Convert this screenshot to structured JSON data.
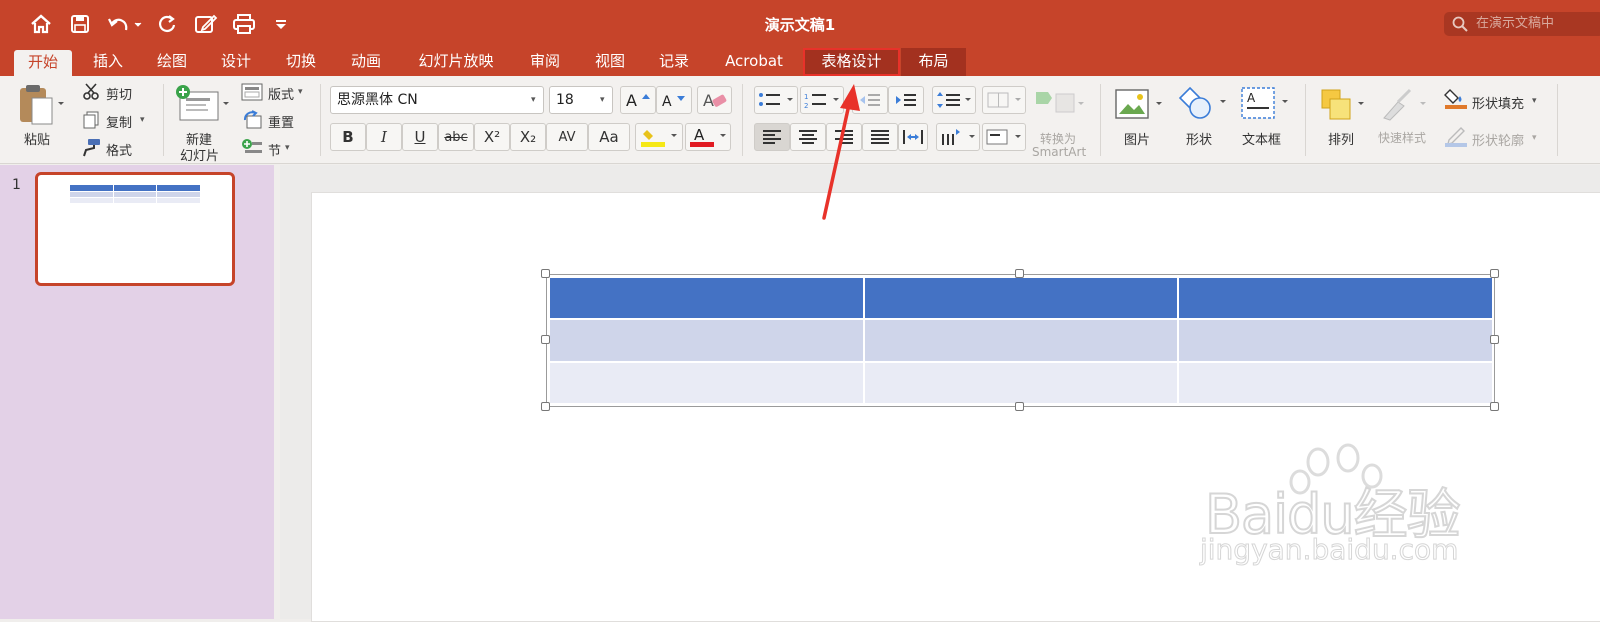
{
  "title_bar": {
    "doc_title": "演示文稿1",
    "search_placeholder": "在演示文稿中"
  },
  "tabs": [
    "开始",
    "插入",
    "绘图",
    "设计",
    "切换",
    "动画",
    "幻灯片放映",
    "审阅",
    "视图",
    "记录",
    "Acrobat",
    "表格设计",
    "布局"
  ],
  "active_tab": "开始",
  "highlighted_tab": "表格设计",
  "ribbon": {
    "paste": "粘贴",
    "cut": "剪切",
    "copy": "复制",
    "format": "格式",
    "new_slide": [
      "新建",
      "幻灯片"
    ],
    "layout": "版式",
    "reset": "重置",
    "section": "节",
    "font_name": "思源黑体 CN",
    "font_size": "18",
    "bold": "B",
    "italic": "I",
    "underline": "U",
    "strike": "abc",
    "superscript": "X²",
    "subscript": "X₂",
    "char_spacing": "AV",
    "change_case": "Aa",
    "smartart": [
      "转换为",
      "SmartArt"
    ],
    "picture": "图片",
    "shapes": "形状",
    "text_box": "文本框",
    "arrange": "排列",
    "quick_styles": "快速样式",
    "shape_fill": "形状填充",
    "shape_outline": "形状轮廓"
  },
  "slides": {
    "thumbnail_number": "1"
  },
  "table": {
    "rows": 3,
    "cols": 3,
    "header_color": "#4472c4",
    "band1_color": "#cfd5ea",
    "band2_color": "#e9ebf5"
  },
  "watermark": {
    "brand": "Baidu经验",
    "url": "jingyan.baidu.com"
  },
  "colors": {
    "accent": "#c6442a",
    "sidebar": "#e3d1e7",
    "annotation_arrow": "#e8322a"
  }
}
